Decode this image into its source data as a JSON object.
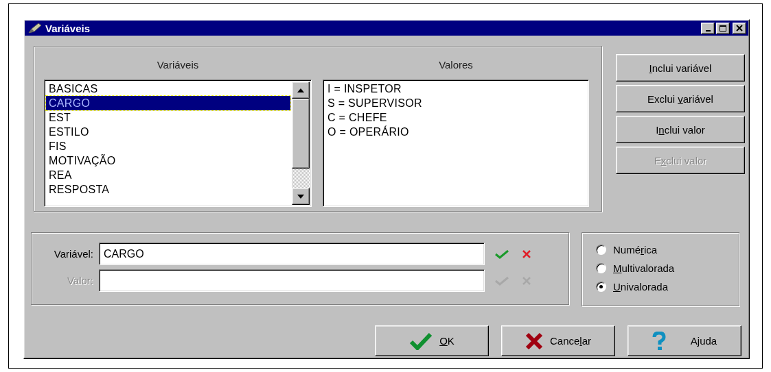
{
  "window": {
    "title": "Variáveis"
  },
  "variables": {
    "heading": "Variáveis",
    "items": [
      {
        "label": "BASICAS",
        "selected": false
      },
      {
        "label": "CARGO",
        "selected": true
      },
      {
        "label": "EST",
        "selected": false
      },
      {
        "label": "ESTILO",
        "selected": false
      },
      {
        "label": "FIS",
        "selected": false
      },
      {
        "label": "MOTIVAÇÃO",
        "selected": false
      },
      {
        "label": "REA",
        "selected": false
      },
      {
        "label": "RESPOSTA",
        "selected": false
      }
    ]
  },
  "values": {
    "heading": "Valores",
    "items": [
      "I = INSPETOR",
      "S = SUPERVISOR",
      "C = CHEFE",
      "O = OPERÁRIO"
    ]
  },
  "actions": [
    {
      "key": "I",
      "post": "nclui variável",
      "disabled": false
    },
    {
      "pre": "Exclui ",
      "key": "v",
      "post": "ariável",
      "disabled": false
    },
    {
      "pre": "I",
      "key": "n",
      "post": "clui valor",
      "disabled": false
    },
    {
      "pre": "E",
      "key": "x",
      "post": "clui valor",
      "disabled": true
    }
  ],
  "fields": [
    {
      "label": "Variável:",
      "value": "CARGO",
      "disabled": false
    },
    {
      "label": "Valor:",
      "disabled": true
    }
  ],
  "types": [
    {
      "pre": "Numé",
      "key": "r",
      "post": "ica",
      "selected": false
    },
    {
      "key": "M",
      "post": "ultivalorada",
      "selected": false
    },
    {
      "key": "U",
      "post": "nivalorada",
      "selected": true
    }
  ],
  "buttons": [
    {
      "kind": "ok",
      "key": "O",
      "post": "K"
    },
    {
      "kind": "cancel",
      "pre": "Cance",
      "key": "l",
      "post": "ar"
    },
    {
      "kind": "help",
      "pre": "Ajuda"
    }
  ]
}
